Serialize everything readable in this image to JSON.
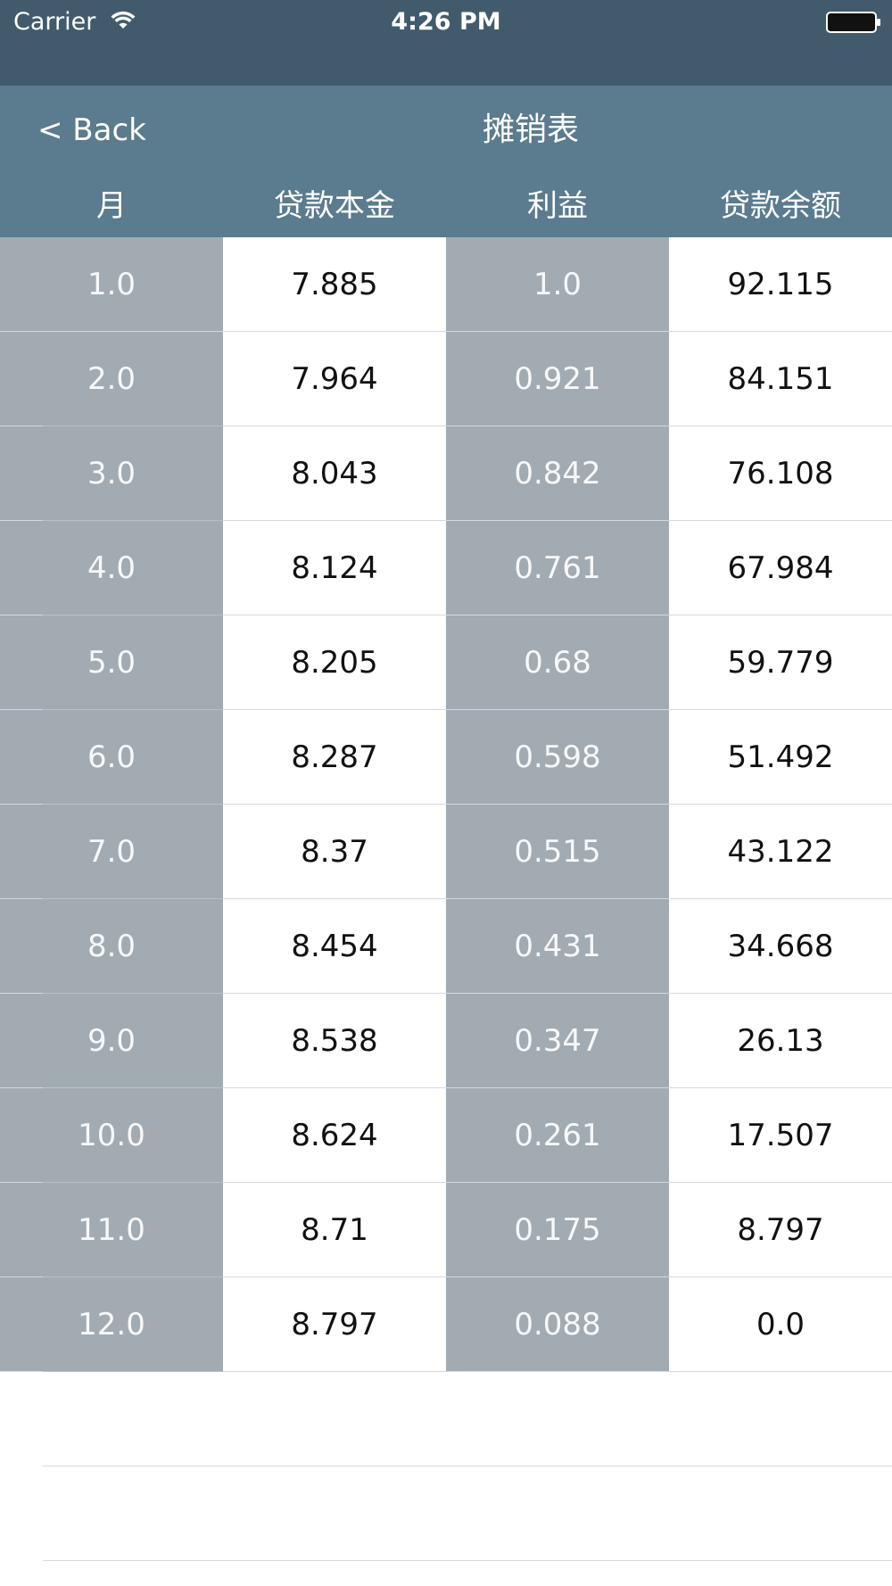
{
  "status_bar": {
    "carrier": "Carrier",
    "time": "4:26 PM",
    "wifi_icon": "wifi-icon",
    "battery_icon": "battery-icon"
  },
  "nav": {
    "back_label": "< Back",
    "title": "摊销表"
  },
  "columns": [
    "月",
    "贷款本金",
    "利益",
    "贷款余额"
  ],
  "rows": [
    {
      "month": "1.0",
      "principal": "7.885",
      "interest": "1.0",
      "balance": "92.115"
    },
    {
      "month": "2.0",
      "principal": "7.964",
      "interest": "0.921",
      "balance": "84.151"
    },
    {
      "month": "3.0",
      "principal": "8.043",
      "interest": "0.842",
      "balance": "76.108"
    },
    {
      "month": "4.0",
      "principal": "8.124",
      "interest": "0.761",
      "balance": "67.984"
    },
    {
      "month": "5.0",
      "principal": "8.205",
      "interest": "0.68",
      "balance": "59.779"
    },
    {
      "month": "6.0",
      "principal": "8.287",
      "interest": "0.598",
      "balance": "51.492"
    },
    {
      "month": "7.0",
      "principal": "8.37",
      "interest": "0.515",
      "balance": "43.122"
    },
    {
      "month": "8.0",
      "principal": "8.454",
      "interest": "0.431",
      "balance": "34.668"
    },
    {
      "month": "9.0",
      "principal": "8.538",
      "interest": "0.347",
      "balance": "26.13"
    },
    {
      "month": "10.0",
      "principal": "8.624",
      "interest": "0.261",
      "balance": "17.507"
    },
    {
      "month": "11.0",
      "principal": "8.71",
      "interest": "0.175",
      "balance": "8.797"
    },
    {
      "month": "12.0",
      "principal": "8.797",
      "interest": "0.088",
      "balance": "0.0"
    }
  ],
  "colors": {
    "status_bar_bg": "#415b6c",
    "nav_bar_bg": "#5b7b8e",
    "gray_column_bg": "#a2abb2",
    "separator": "#d6d9dc"
  }
}
